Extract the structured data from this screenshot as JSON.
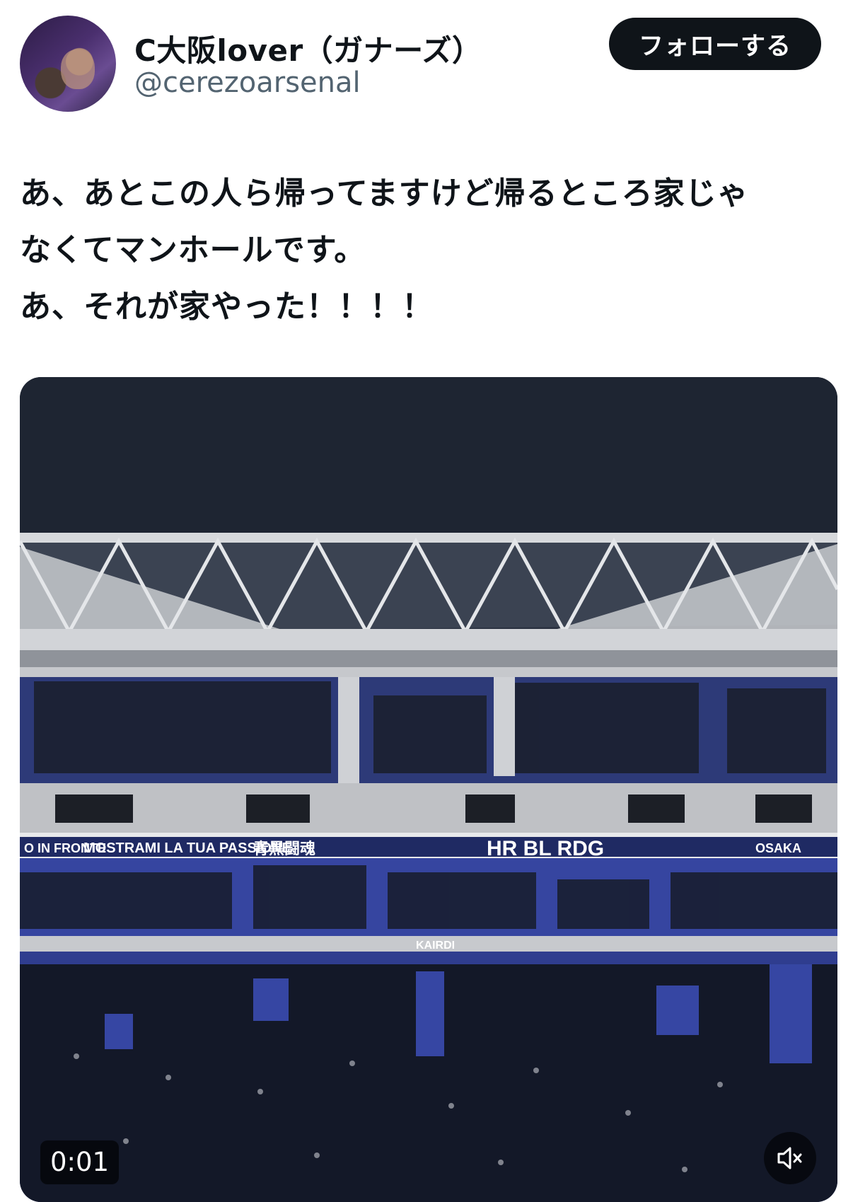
{
  "user": {
    "display_name": "C大阪lover（ガナーズ）",
    "handle": "@cerezoarsenal",
    "avatar_icon": "avatar-photo"
  },
  "follow_button": {
    "label": "フォローする"
  },
  "tweet": {
    "text": "あ、あとこの人ら帰ってますけど帰るところ家じゃ\nなくてマンホールです。\nあ、それが家やった！！！！"
  },
  "video": {
    "timestamp": "0:01",
    "mute_icon": "speaker-muted-icon",
    "banners": [
      "O IN FRONTE",
      "MOSTRAMI LA TUA PASSIONE",
      "青黒闘魂",
      "HR BL RDG",
      "OSAKA",
      "KAIRDI"
    ]
  },
  "colors": {
    "follow_bg": "#0f1419",
    "handle_gray": "#536471",
    "seat_blue": "#3a4aa8",
    "night_sky": "#1d2430"
  }
}
